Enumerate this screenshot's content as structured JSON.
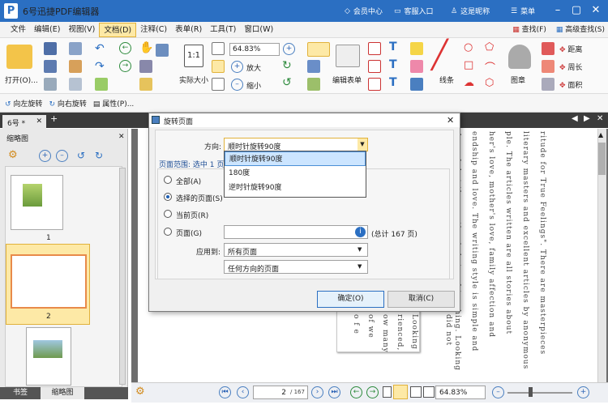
{
  "title_bar": {
    "app_icon": "P",
    "title": "6号迅捷PDF编辑器",
    "member": "会员中心",
    "support": "客服入口",
    "nickname": "这是昵称",
    "menu": "菜单"
  },
  "menu_bar": {
    "items": [
      "文件",
      "编辑(E)",
      "视图(V)",
      "文档(D)",
      "注释(C)",
      "表单(R)",
      "工具(T)",
      "窗口(W)"
    ],
    "active_index": 3,
    "find": "查找(F)",
    "advanced_find": "高级查找(S)"
  },
  "ribbon": {
    "open": "打开(O)...",
    "actual_size": "实际大小",
    "zoom": "64.83%",
    "zoom_in": "放大",
    "zoom_out": "缩小",
    "edit_form": "编辑表单",
    "line": "线条",
    "stamp": "图章",
    "distance": "距离",
    "perimeter": "周长",
    "area": "面积"
  },
  "toolbar2": {
    "rotate_left": "向左旋转",
    "rotate_right": "向右旋转",
    "properties": "属性(P)..."
  },
  "doc_tab": "6号 *",
  "sidebar": {
    "title": "缩略图",
    "page_labels": [
      "1",
      "2"
    ],
    "tab_bookmarks": "书签",
    "tab_thumbs": "缩略图"
  },
  "document": {
    "columns": [
      "ritude for True Feelings\". There are masterpieces",
      "literary masters and excellent articles by anonymous",
      "ple. The articles written are all stories about",
      "her's love, mother's love, family affection and",
      "endship and love. The writing style is simple and",
      "dorned, but the emotion is hot and touching. Looking",
      "ow many",
      "of we",
      "o f e",
      "rienced,",
      "Looking",
      "did not"
    ]
  },
  "status_bar": {
    "page_current": "2",
    "page_total": "/ 167",
    "zoom": "64.83%"
  },
  "dialog": {
    "title": "旋转页面",
    "direction_label": "方向:",
    "direction_value": "顺时针旋转90度",
    "range_label": "页面范围: 选中 1 页",
    "options": {
      "all": "全部(A)",
      "selected": "选择的页面(S)",
      "current": "当前页(R)",
      "pages": "页面(G)"
    },
    "selected_option": "selected",
    "pages_total": "(总计 167 页)",
    "apply_label": "应用到:",
    "apply_value": "所有页面",
    "orientation_value": "任何方向的页面",
    "ok": "确定(O)",
    "cancel": "取消(C)",
    "dropdown_items": [
      "顺时针旋转90度",
      "180度",
      "逆时针旋转90度"
    ],
    "dropdown_selected": 0
  },
  "colors": {
    "title_bar": "#2b6fc2",
    "doc_background": "#6d6d6d",
    "highlight": "#cce5ff"
  }
}
